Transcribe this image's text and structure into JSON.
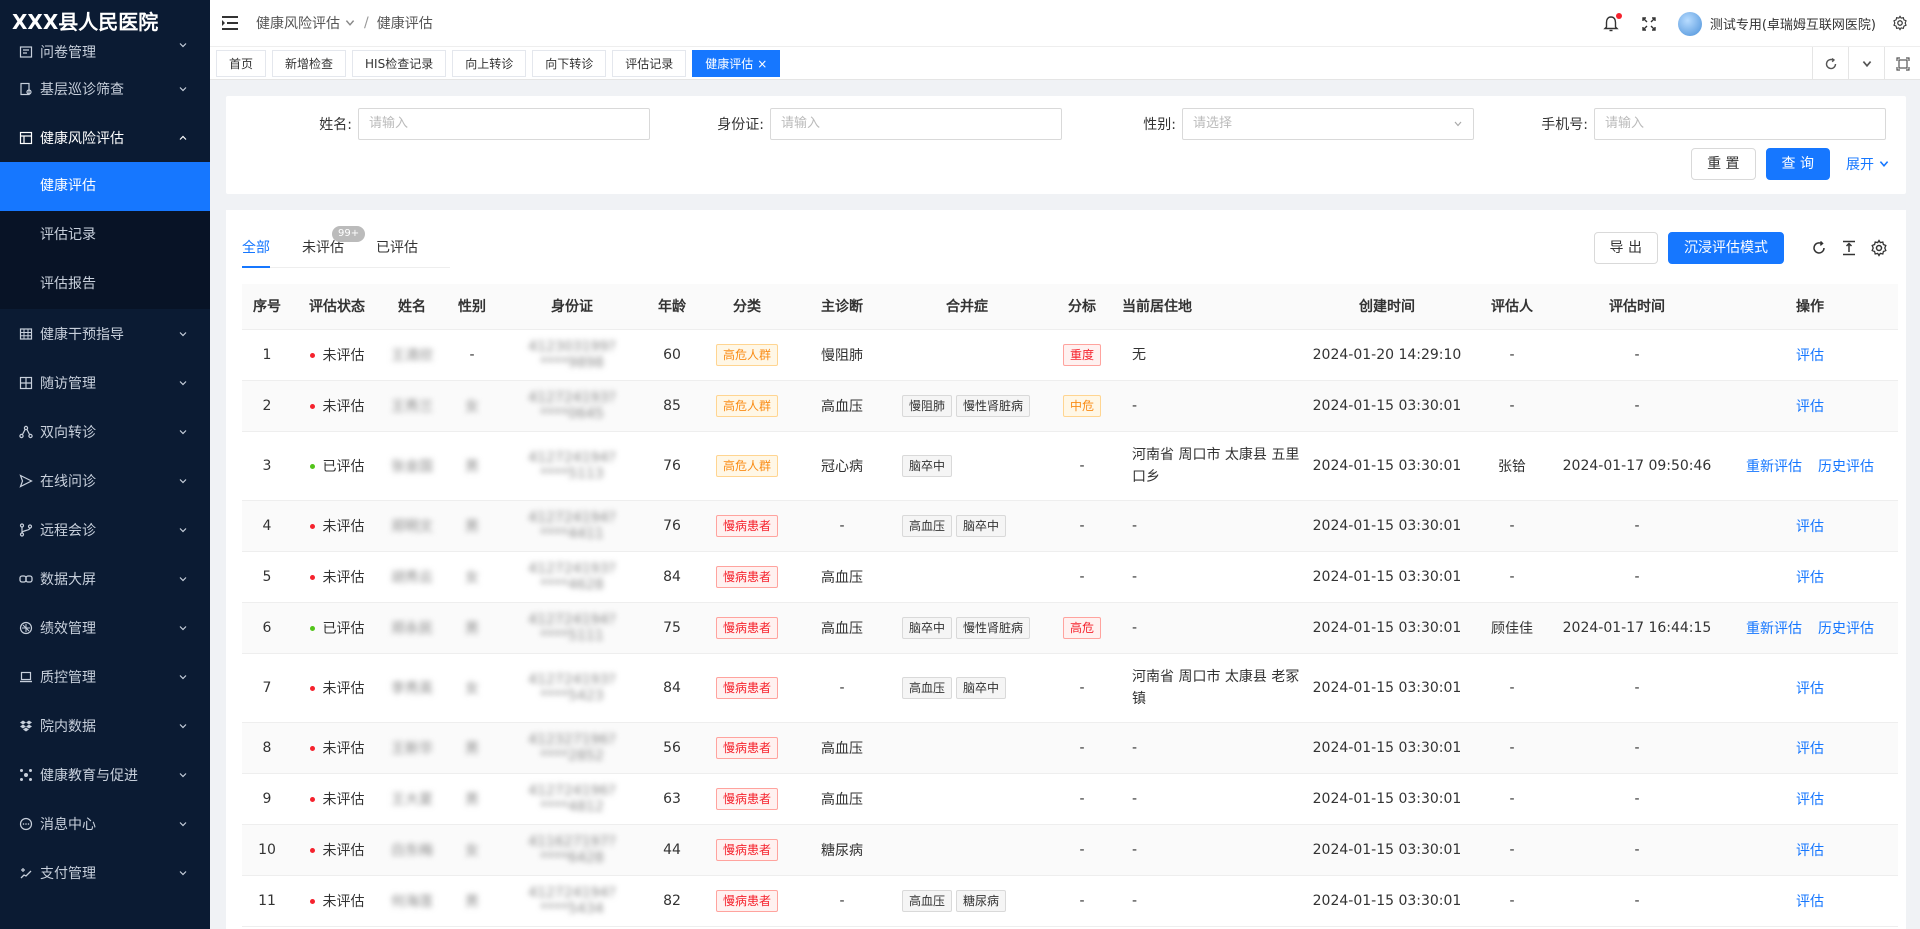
{
  "app": {
    "hospital_name": "XXX县人民医院"
  },
  "sidebar": {
    "items": [
      {
        "label": "问卷管理",
        "icon": "questionnaire-icon"
      },
      {
        "label": "基层巡诊筛查",
        "icon": "screening-icon"
      },
      {
        "label": "健康风险评估",
        "icon": "risk-assessment-icon",
        "open": true,
        "children": [
          {
            "label": "健康评估",
            "active": true
          },
          {
            "label": "评估记录"
          },
          {
            "label": "评估报告"
          }
        ]
      },
      {
        "label": "健康干预指导",
        "icon": "grid-icon"
      },
      {
        "label": "随访管理",
        "icon": "followup-icon"
      },
      {
        "label": "双向转诊",
        "icon": "referral-icon"
      },
      {
        "label": "在线问诊",
        "icon": "send-icon"
      },
      {
        "label": "远程会诊",
        "icon": "branch-icon"
      },
      {
        "label": "数据大屏",
        "icon": "link-icon"
      },
      {
        "label": "绩效管理",
        "icon": "performance-icon"
      },
      {
        "label": "质控管理",
        "icon": "laptop-icon"
      },
      {
        "label": "院内数据",
        "icon": "dropbox-icon"
      },
      {
        "label": "健康教育与促进",
        "icon": "cluster-icon"
      },
      {
        "label": "消息中心",
        "icon": "message-icon"
      },
      {
        "label": "支付管理",
        "icon": "payment-icon"
      }
    ]
  },
  "header": {
    "breadcrumb": [
      "健康风险评估",
      "健康评估"
    ],
    "user_name": "测试专用(卓瑞姆互联网医院)"
  },
  "tabs": [
    {
      "label": "首页"
    },
    {
      "label": "新增检查"
    },
    {
      "label": "HIS检查记录"
    },
    {
      "label": "向上转诊"
    },
    {
      "label": "向下转诊"
    },
    {
      "label": "评估记录"
    },
    {
      "label": "健康评估",
      "active": true,
      "close": "×"
    }
  ],
  "filter": {
    "name_label": "姓名:",
    "name_placeholder": "请输入",
    "id_label": "身份证:",
    "id_placeholder": "请输入",
    "gender_label": "性别:",
    "gender_placeholder": "请选择",
    "phone_label": "手机号:",
    "phone_placeholder": "请输入",
    "reset_label": "重 置",
    "query_label": "查 询",
    "expand_label": "展开"
  },
  "status_tabs": {
    "all": "全部",
    "pending": "未评估",
    "pending_badge": "99+",
    "done": "已评估"
  },
  "toolbar": {
    "export_label": "导 出",
    "immersive_label": "沉浸评估模式"
  },
  "table": {
    "headers": [
      "序号",
      "评估状态",
      "姓名",
      "性别",
      "身份证",
      "年龄",
      "分类",
      "主诊断",
      "合并症",
      "分标",
      "当前居住地",
      "创建时间",
      "评估人",
      "评估时间",
      "操作"
    ],
    "rows": [
      {
        "no": "1",
        "status": "未评估",
        "status_color": "#f5222d",
        "name": "王清欣",
        "gender": "-",
        "idcard": "412303199?****9898",
        "age": "60",
        "category": "高危人群",
        "category_type": "orange",
        "diagnosis": "慢阻肺",
        "comorbidity": [],
        "level": "重度",
        "level_type": "red",
        "address": "无",
        "created": "2024-01-20 14:29:10",
        "assessor": "-",
        "assessed": "-",
        "ops": [
          "评估"
        ],
        "tall": false
      },
      {
        "no": "2",
        "status": "未评估",
        "status_color": "#f5222d",
        "name": "王秀兰",
        "gender": "女",
        "idcard": "412724193?****0645",
        "age": "85",
        "category": "高危人群",
        "category_type": "orange",
        "diagnosis": "高血压",
        "comorbidity": [
          "慢阻肺",
          "慢性肾脏病"
        ],
        "level": "中危",
        "level_type": "orange",
        "address": "-",
        "created": "2024-01-15 03:30:01",
        "assessor": "-",
        "assessed": "-",
        "ops": [
          "评估"
        ],
        "tall": false
      },
      {
        "no": "3",
        "status": "已评估",
        "status_color": "#52c41a",
        "name": "张金国",
        "gender": "男",
        "idcard": "412724194?****5113",
        "age": "76",
        "category": "高危人群",
        "category_type": "orange",
        "diagnosis": "冠心病",
        "comorbidity": [
          "脑卒中"
        ],
        "level": "-",
        "level_type": "",
        "address": "河南省 周口市 太康县 五里口乡",
        "created": "2024-01-15 03:30:01",
        "assessor": "张铪",
        "assessed": "2024-01-17 09:50:46",
        "ops": [
          "重新评估",
          "历史评估"
        ],
        "tall": true
      },
      {
        "no": "4",
        "status": "未评估",
        "status_color": "#f5222d",
        "name": "郑明文",
        "gender": "男",
        "idcard": "412724194?****4411",
        "age": "76",
        "category": "慢病患者",
        "category_type": "red",
        "diagnosis": "-",
        "comorbidity": [
          "高血压",
          "脑卒中"
        ],
        "level": "-",
        "level_type": "",
        "address": "-",
        "created": "2024-01-15 03:30:01",
        "assessor": "-",
        "assessed": "-",
        "ops": [
          "评估"
        ],
        "tall": false
      },
      {
        "no": "5",
        "status": "未评估",
        "status_color": "#f5222d",
        "name": "胡秀云",
        "gender": "女",
        "idcard": "412724193?****4628",
        "age": "84",
        "category": "慢病患者",
        "category_type": "red",
        "diagnosis": "高血压",
        "comorbidity": [],
        "level": "-",
        "level_type": "",
        "address": "-",
        "created": "2024-01-15 03:30:01",
        "assessor": "-",
        "assessed": "-",
        "ops": [
          "评估"
        ],
        "tall": false
      },
      {
        "no": "6",
        "status": "已评估",
        "status_color": "#52c41a",
        "name": "郑永民",
        "gender": "男",
        "idcard": "412724194?****5111",
        "age": "75",
        "category": "慢病患者",
        "category_type": "red",
        "diagnosis": "高血压",
        "comorbidity": [
          "脑卒中",
          "慢性肾脏病"
        ],
        "level": "高危",
        "level_type": "red",
        "address": "-",
        "created": "2024-01-15 03:30:01",
        "assessor": "顾佳佳",
        "assessed": "2024-01-17 16:44:15",
        "ops": [
          "重新评估",
          "历史评估"
        ],
        "tall": false
      },
      {
        "no": "7",
        "status": "未评估",
        "status_color": "#f5222d",
        "name": "李秀英",
        "gender": "女",
        "idcard": "412724193?****5423",
        "age": "84",
        "category": "慢病患者",
        "category_type": "red",
        "diagnosis": "-",
        "comorbidity": [
          "高血压",
          "脑卒中"
        ],
        "level": "-",
        "level_type": "",
        "address": "河南省 周口市 太康县 老冢镇",
        "created": "2024-01-15 03:30:01",
        "assessor": "-",
        "assessed": "-",
        "ops": [
          "评估"
        ],
        "tall": true
      },
      {
        "no": "8",
        "status": "未评估",
        "status_color": "#f5222d",
        "name": "王新华",
        "gender": "男",
        "idcard": "412327196?****2852",
        "age": "56",
        "category": "慢病患者",
        "category_type": "red",
        "diagnosis": "高血压",
        "comorbidity": [],
        "level": "-",
        "level_type": "",
        "address": "-",
        "created": "2024-01-15 03:30:01",
        "assessor": "-",
        "assessed": "-",
        "ops": [
          "评估"
        ],
        "tall": false
      },
      {
        "no": "9",
        "status": "未评估",
        "status_color": "#f5222d",
        "name": "王大夏",
        "gender": "男",
        "idcard": "412724196?****4812",
        "age": "63",
        "category": "慢病患者",
        "category_type": "red",
        "diagnosis": "高血压",
        "comorbidity": [],
        "level": "-",
        "level_type": "",
        "address": "-",
        "created": "2024-01-15 03:30:01",
        "assessor": "-",
        "assessed": "-",
        "ops": [
          "评估"
        ],
        "tall": false
      },
      {
        "no": "10",
        "status": "未评估",
        "status_color": "#f5222d",
        "name": "白东梅",
        "gender": "女",
        "idcard": "411627197?****6428",
        "age": "44",
        "category": "慢病患者",
        "category_type": "red",
        "diagnosis": "糖尿病",
        "comorbidity": [],
        "level": "-",
        "level_type": "",
        "address": "-",
        "created": "2024-01-15 03:30:01",
        "assessor": "-",
        "assessed": "-",
        "ops": [
          "评估"
        ],
        "tall": false
      },
      {
        "no": "11",
        "status": "未评估",
        "status_color": "#f5222d",
        "name": "何海莲",
        "gender": "男",
        "idcard": "412724194?****5434",
        "age": "82",
        "category": "慢病患者",
        "category_type": "red",
        "diagnosis": "-",
        "comorbidity": [
          "高血压",
          "糖尿病"
        ],
        "level": "-",
        "level_type": "",
        "address": "-",
        "created": "2024-01-15 03:30:01",
        "assessor": "-",
        "assessed": "-",
        "ops": [
          "评估"
        ],
        "tall": false
      }
    ]
  }
}
